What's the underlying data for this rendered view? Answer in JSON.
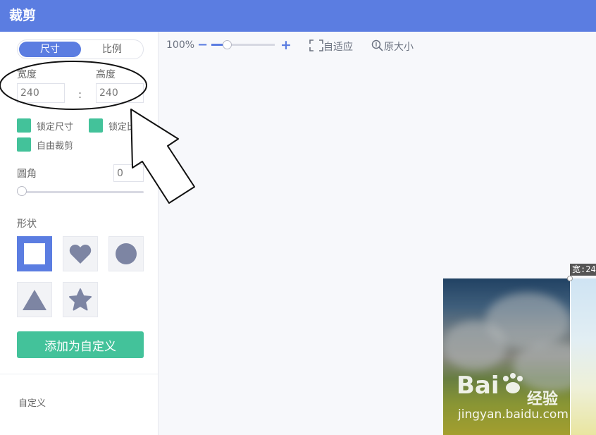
{
  "window": {
    "title": "裁剪"
  },
  "panel": {
    "mode_tabs": [
      {
        "label": "尺寸",
        "active": true
      },
      {
        "label": "比例",
        "active": false
      }
    ],
    "width_label": "宽度",
    "height_label": "高度",
    "width_value": "240",
    "height_value": "240",
    "separator": ":",
    "checkboxes": [
      {
        "label": "锁定尺寸"
      },
      {
        "label": "锁定比例"
      },
      {
        "label": "自由裁剪"
      }
    ],
    "radius_label": "圆角",
    "radius_value": "0",
    "shape_label": "形状",
    "shapes": [
      "square-icon",
      "heart-icon",
      "circle-icon",
      "triangle-icon",
      "star-icon"
    ],
    "selected_shape": "square",
    "add_custom_button": "添加为自定义",
    "custom_section_title": "自定义"
  },
  "toolbar": {
    "zoom_value": "100%",
    "zoom_out": "−",
    "zoom_in": "+",
    "fit_label": "自适应",
    "original_label": "原大小"
  },
  "canvas": {
    "crop_info": "宽:24",
    "watermark_logo": "Bai",
    "watermark_logo_cn": "经验",
    "watermark_url": "jingyan.baidu.com"
  },
  "colors": {
    "accent": "#5b7de1",
    "checkbox": "#43c29a",
    "shape_icon": "#7d85a3"
  }
}
